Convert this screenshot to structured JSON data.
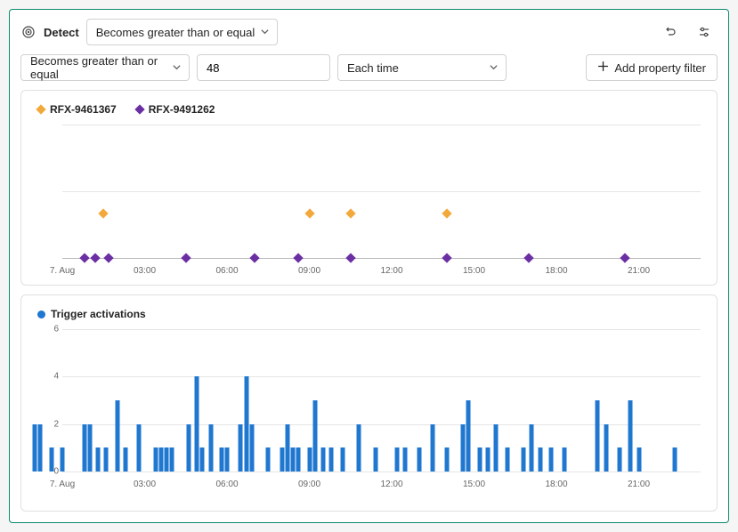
{
  "header": {
    "title": "Detect",
    "condition_dropdown": "Becomes greater than or equal"
  },
  "filter": {
    "condition": "Becomes greater than or equal",
    "value": "48",
    "frequency": "Each time",
    "add_button": "Add property filter"
  },
  "colors": {
    "series1": "#f2a93b",
    "series2": "#6b2fa3",
    "bars": "#1f77d0"
  },
  "chart_data": [
    {
      "type": "scatter",
      "legend": [
        {
          "name": "RFX-9461367",
          "color": "#f2a93b"
        },
        {
          "name": "RFX-9491262",
          "color": "#6b2fa3"
        }
      ],
      "xrange": [
        0,
        24
      ],
      "xticks": [
        {
          "x": 0,
          "label": "7. Aug"
        },
        {
          "x": 3,
          "label": "03:00"
        },
        {
          "x": 6,
          "label": "06:00"
        },
        {
          "x": 9,
          "label": "09:00"
        },
        {
          "x": 12,
          "label": "12:00"
        },
        {
          "x": 15,
          "label": "15:00"
        },
        {
          "x": 18,
          "label": "18:00"
        },
        {
          "x": 21,
          "label": "21:00"
        }
      ],
      "yrange": [
        0,
        3
      ],
      "gridlines_y": [
        0,
        1.5,
        3
      ],
      "series": [
        {
          "name": "RFX-9461367",
          "color": "#f2a93b",
          "points": [
            {
              "x": 1.5,
              "y": 1
            },
            {
              "x": 9.0,
              "y": 1
            },
            {
              "x": 10.5,
              "y": 1
            },
            {
              "x": 14.0,
              "y": 1
            }
          ]
        },
        {
          "name": "RFX-9491262",
          "color": "#6b2fa3",
          "points": [
            {
              "x": 0.8,
              "y": 0
            },
            {
              "x": 1.2,
              "y": 0
            },
            {
              "x": 1.7,
              "y": 0
            },
            {
              "x": 4.5,
              "y": 0
            },
            {
              "x": 7.0,
              "y": 0
            },
            {
              "x": 8.6,
              "y": 0
            },
            {
              "x": 10.5,
              "y": 0
            },
            {
              "x": 14.0,
              "y": 0
            },
            {
              "x": 17.0,
              "y": 0
            },
            {
              "x": 20.5,
              "y": 0
            }
          ]
        }
      ]
    },
    {
      "type": "bar",
      "legend": [
        {
          "name": "Trigger activations",
          "color": "#1f77d0"
        }
      ],
      "xrange": [
        0,
        24
      ],
      "yrange": [
        0,
        6
      ],
      "yticks": [
        0,
        2,
        4,
        6
      ],
      "xticks": [
        {
          "x": 0,
          "label": "7. Aug"
        },
        {
          "x": 3,
          "label": "03:00"
        },
        {
          "x": 6,
          "label": "06:00"
        },
        {
          "x": 9,
          "label": "09:00"
        },
        {
          "x": 12,
          "label": "12:00"
        },
        {
          "x": 15,
          "label": "15:00"
        },
        {
          "x": 18,
          "label": "18:00"
        },
        {
          "x": 21,
          "label": "21:00"
        }
      ],
      "bars": [
        {
          "x": -1.0,
          "v": 2
        },
        {
          "x": -0.8,
          "v": 2
        },
        {
          "x": -0.4,
          "v": 1
        },
        {
          "x": 0.0,
          "v": 1
        },
        {
          "x": 0.8,
          "v": 2
        },
        {
          "x": 1.0,
          "v": 2
        },
        {
          "x": 1.3,
          "v": 1
        },
        {
          "x": 1.6,
          "v": 1
        },
        {
          "x": 2.0,
          "v": 3
        },
        {
          "x": 2.3,
          "v": 1
        },
        {
          "x": 2.8,
          "v": 2
        },
        {
          "x": 3.4,
          "v": 1
        },
        {
          "x": 3.6,
          "v": 1
        },
        {
          "x": 3.8,
          "v": 1
        },
        {
          "x": 4.0,
          "v": 1
        },
        {
          "x": 4.6,
          "v": 2
        },
        {
          "x": 4.9,
          "v": 4
        },
        {
          "x": 5.1,
          "v": 1
        },
        {
          "x": 5.4,
          "v": 2
        },
        {
          "x": 5.8,
          "v": 1
        },
        {
          "x": 6.0,
          "v": 1
        },
        {
          "x": 6.5,
          "v": 2
        },
        {
          "x": 6.7,
          "v": 4
        },
        {
          "x": 6.9,
          "v": 2
        },
        {
          "x": 7.5,
          "v": 1
        },
        {
          "x": 8.0,
          "v": 1
        },
        {
          "x": 8.2,
          "v": 2
        },
        {
          "x": 8.4,
          "v": 1
        },
        {
          "x": 8.6,
          "v": 1
        },
        {
          "x": 9.0,
          "v": 1
        },
        {
          "x": 9.2,
          "v": 3
        },
        {
          "x": 9.5,
          "v": 1
        },
        {
          "x": 9.8,
          "v": 1
        },
        {
          "x": 10.2,
          "v": 1
        },
        {
          "x": 10.8,
          "v": 2
        },
        {
          "x": 11.4,
          "v": 1
        },
        {
          "x": 12.2,
          "v": 1
        },
        {
          "x": 12.5,
          "v": 1
        },
        {
          "x": 13.0,
          "v": 1
        },
        {
          "x": 13.5,
          "v": 2
        },
        {
          "x": 14.0,
          "v": 1
        },
        {
          "x": 14.6,
          "v": 2
        },
        {
          "x": 14.8,
          "v": 3
        },
        {
          "x": 15.2,
          "v": 1
        },
        {
          "x": 15.5,
          "v": 1
        },
        {
          "x": 15.8,
          "v": 2
        },
        {
          "x": 16.2,
          "v": 1
        },
        {
          "x": 16.8,
          "v": 1
        },
        {
          "x": 17.1,
          "v": 2
        },
        {
          "x": 17.4,
          "v": 1
        },
        {
          "x": 17.8,
          "v": 1
        },
        {
          "x": 18.3,
          "v": 1
        },
        {
          "x": 19.5,
          "v": 3
        },
        {
          "x": 19.8,
          "v": 2
        },
        {
          "x": 20.3,
          "v": 1
        },
        {
          "x": 20.7,
          "v": 3
        },
        {
          "x": 21.0,
          "v": 1
        },
        {
          "x": 22.3,
          "v": 1
        }
      ]
    }
  ]
}
